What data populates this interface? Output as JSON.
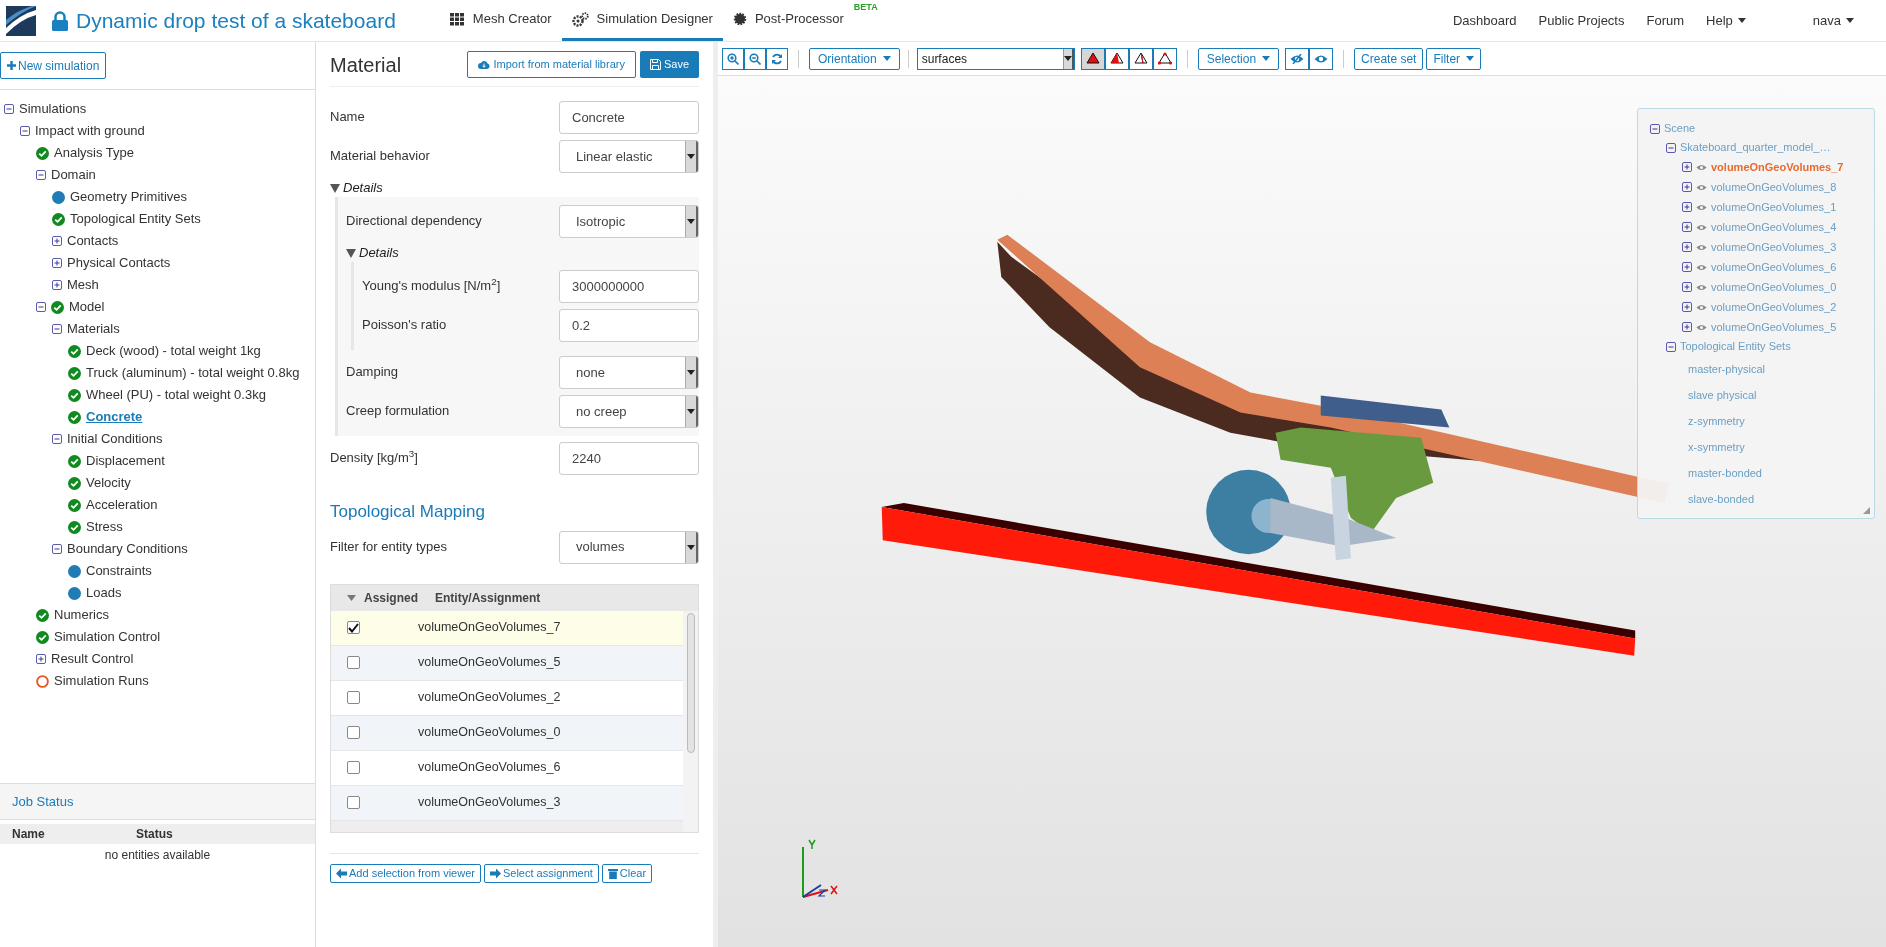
{
  "header": {
    "title": "Dynamic drop test of a skateboard",
    "tabs": [
      {
        "label": "Mesh Creator",
        "selected": false
      },
      {
        "label": "Simulation Designer",
        "selected": true
      },
      {
        "label": "Post-Processor",
        "badge": "BETA",
        "selected": false
      }
    ],
    "links": [
      "Dashboard",
      "Public Projects",
      "Forum"
    ],
    "menus": [
      "Help",
      "nava"
    ]
  },
  "sidebar": {
    "new_button": "New simulation",
    "tree": [
      {
        "label": "Simulations",
        "expanded": true,
        "selected": false,
        "children": [
          {
            "label": "Impact with ground",
            "expanded": true,
            "selected": false,
            "children": [
              {
                "label": "Analysis Type",
                "kind": "done",
                "selected": false
              },
              {
                "label": "Domain",
                "expanded": true,
                "selected": false,
                "children": [
                  {
                    "label": "Geometry Primitives",
                    "kind": "info",
                    "selected": false
                  },
                  {
                    "label": "Topological Entity Sets",
                    "kind": "done",
                    "selected": false
                  },
                  {
                    "label": "Contacts",
                    "expanded": false,
                    "selected": false
                  },
                  {
                    "label": "Physical Contacts",
                    "expanded": false,
                    "selected": false
                  },
                  {
                    "label": "Mesh",
                    "expanded": false,
                    "selected": false
                  }
                ]
              },
              {
                "label": "Model",
                "expanded": true,
                "kind": "done",
                "selected": false,
                "children": [
                  {
                    "label": "Materials",
                    "expanded": true,
                    "selected": false,
                    "children": [
                      {
                        "label": "Deck (wood) - total weight 1kg",
                        "kind": "done",
                        "selected": false
                      },
                      {
                        "label": "Truck (aluminum) - total weight 0.8kg",
                        "kind": "done",
                        "selected": false
                      },
                      {
                        "label": "Wheel (PU) - total weight 0.3kg",
                        "kind": "done",
                        "selected": false
                      },
                      {
                        "label": "Concrete",
                        "kind": "done",
                        "selected": true
                      }
                    ]
                  },
                  {
                    "label": "Initial Conditions",
                    "expanded": true,
                    "selected": false,
                    "children": [
                      {
                        "label": "Displacement",
                        "kind": "done",
                        "selected": false
                      },
                      {
                        "label": "Velocity",
                        "kind": "done",
                        "selected": false
                      },
                      {
                        "label": "Acceleration",
                        "kind": "done",
                        "selected": false
                      },
                      {
                        "label": "Stress",
                        "kind": "done",
                        "selected": false
                      }
                    ]
                  },
                  {
                    "label": "Boundary Conditions",
                    "expanded": true,
                    "selected": false,
                    "children": [
                      {
                        "label": "Constraints",
                        "kind": "info",
                        "selected": false
                      },
                      {
                        "label": "Loads",
                        "kind": "info",
                        "selected": false
                      }
                    ]
                  }
                ]
              },
              {
                "label": "Numerics",
                "kind": "done",
                "selected": false
              },
              {
                "label": "Simulation Control",
                "kind": "done",
                "selected": false
              },
              {
                "label": "Result Control",
                "expanded": false,
                "selected": false
              },
              {
                "label": "Simulation Runs",
                "kind": "empty",
                "selected": false
              }
            ]
          }
        ]
      }
    ],
    "job_status": {
      "title": "Job Status",
      "columns": [
        "Name",
        "Status"
      ],
      "empty_text": "no entities available"
    }
  },
  "material": {
    "title": "Material",
    "import_button": "Import from material library",
    "save_button": "Save",
    "fields": [
      {
        "kind": "input",
        "label": "Name",
        "value": "Concrete"
      },
      {
        "kind": "select",
        "label": "Material behavior",
        "value": "Linear elastic"
      },
      {
        "kind": "group",
        "label": "Details",
        "expanded": true,
        "fields": [
          {
            "kind": "select",
            "label": "Directional dependency",
            "value": "Isotropic"
          },
          {
            "kind": "group",
            "label": "Details",
            "expanded": true,
            "fields": [
              {
                "kind": "input",
                "label": "Young's modulus [N/m$^{2}$]",
                "value": "3000000000"
              },
              {
                "kind": "input",
                "label": "Poisson's ratio",
                "value": "0.2"
              }
            ]
          },
          {
            "kind": "select",
            "label": "Damping",
            "value": "none"
          },
          {
            "kind": "select",
            "label": "Creep formulation",
            "value": "no creep"
          }
        ]
      },
      {
        "kind": "input",
        "label": "Density [kg/m$^{3}$]",
        "value": "2240"
      }
    ]
  },
  "mapping": {
    "title": "Topological Mapping",
    "filter_label": "Filter for entity types",
    "filter_value": "volumes",
    "columns": [
      "Assigned",
      "Entity/Assignment"
    ],
    "rows": [
      {
        "entity": "volumeOnGeoVolumes_7",
        "checked": true
      },
      {
        "entity": "volumeOnGeoVolumes_5",
        "checked": false
      },
      {
        "entity": "volumeOnGeoVolumes_2",
        "checked": false
      },
      {
        "entity": "volumeOnGeoVolumes_0",
        "checked": false
      },
      {
        "entity": "volumeOnGeoVolumes_6",
        "checked": false
      },
      {
        "entity": "volumeOnGeoVolumes_3",
        "checked": false
      }
    ],
    "buttons": [
      "Add selection from viewer",
      "Select assignment",
      "Clear"
    ]
  },
  "viewer": {
    "orientation": "Orientation",
    "display_value": "surfaces",
    "render_modes": [
      {
        "selected": true
      },
      {
        "selected": false
      },
      {
        "selected": false
      },
      {
        "selected": false
      }
    ],
    "selection": "Selection",
    "create_set": "Create set",
    "filter": "Filter",
    "scene": {
      "label": "Scene",
      "expanded": true,
      "children": [
        {
          "label": "Skateboard_quarter_model_…",
          "expanded": true,
          "children": [
            {
              "label": "volumeOnGeoVolumes_7",
              "selected": true
            },
            {
              "label": "volumeOnGeoVolumes_8",
              "selected": false
            },
            {
              "label": "volumeOnGeoVolumes_1",
              "selected": false
            },
            {
              "label": "volumeOnGeoVolumes_4",
              "selected": false
            },
            {
              "label": "volumeOnGeoVolumes_3",
              "selected": false
            },
            {
              "label": "volumeOnGeoVolumes_6",
              "selected": false
            },
            {
              "label": "volumeOnGeoVolumes_0",
              "selected": false
            },
            {
              "label": "volumeOnGeoVolumes_2",
              "selected": false
            },
            {
              "label": "volumeOnGeoVolumes_5",
              "selected": false
            }
          ]
        },
        {
          "label": "Topological Entity Sets",
          "expanded": true,
          "sets": [
            "master-physical",
            "slave physical",
            "z-symmetry",
            "x-symmetry",
            "master-bonded",
            "slave-bonded"
          ]
        }
      ]
    }
  }
}
